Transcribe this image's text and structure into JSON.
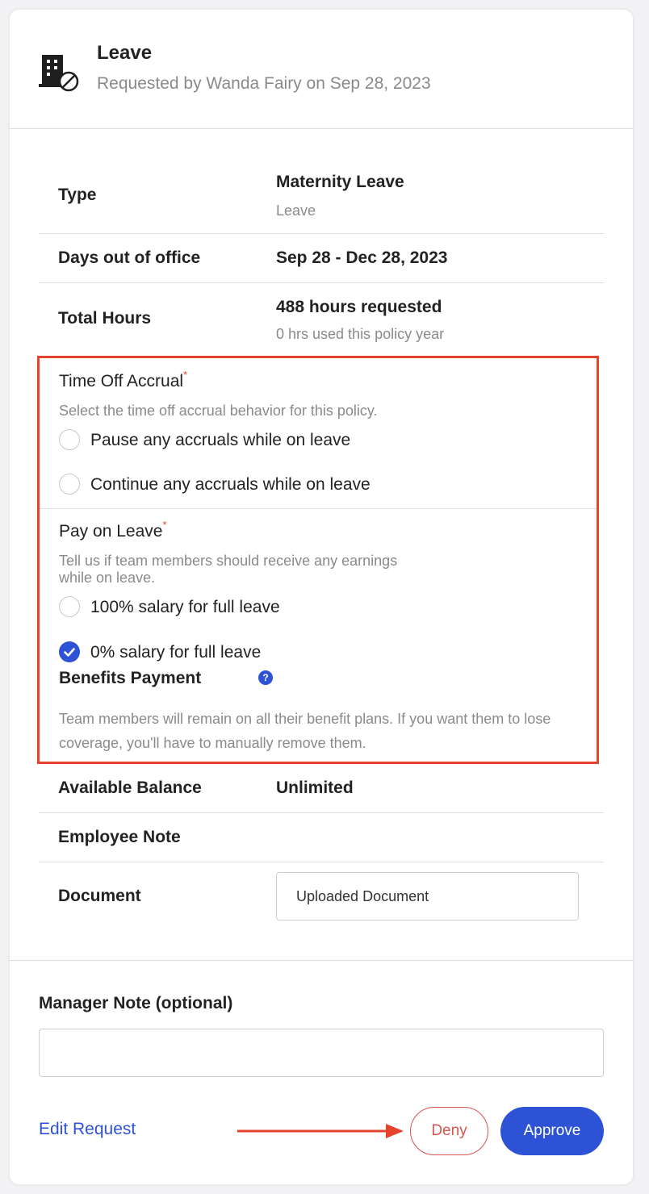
{
  "header": {
    "title": "Leave",
    "subtitle": "Requested by Wanda Fairy on Sep 28, 2023",
    "icon": "building-blocked-icon"
  },
  "details": {
    "type": {
      "label": "Type",
      "value": "Maternity Leave",
      "sub": "Leave"
    },
    "days": {
      "label": "Days out of office",
      "value": "Sep 28 - Dec 28, 2023"
    },
    "hours": {
      "label": "Total Hours",
      "value": "488 hours requested",
      "sub": "0 hrs used this policy year"
    }
  },
  "accrual": {
    "title": "Time Off Accrual",
    "required_mark": "*",
    "description": "Select the time off accrual behavior for this policy.",
    "options": [
      {
        "label": "Pause any accruals while on leave",
        "checked": false
      },
      {
        "label": "Continue any accruals while on leave",
        "checked": false
      }
    ]
  },
  "pay": {
    "title": "Pay on Leave",
    "required_mark": "*",
    "description_line1": "Tell us if team members should receive any earnings",
    "description_line2": "while on leave.",
    "options": [
      {
        "label": "100% salary for full leave",
        "checked": false
      },
      {
        "label": "0% salary for full leave",
        "checked": true
      }
    ]
  },
  "benefits": {
    "title": "Benefits Payment",
    "help_glyph": "?",
    "note": "Team members will remain on all their benefit plans. If you want them to lose coverage, you'll have to manually remove them."
  },
  "balance": {
    "label": "Available Balance",
    "value": "Unlimited"
  },
  "employee_note": {
    "label": "Employee Note"
  },
  "document": {
    "label": "Document",
    "value": "Uploaded Document"
  },
  "manager_note": {
    "label": "Manager Note (optional)",
    "value": ""
  },
  "actions": {
    "edit": "Edit Request",
    "deny": "Deny",
    "approve": "Approve"
  },
  "colors": {
    "accent": "#2d52d6",
    "annotation_red": "#e5432c",
    "deny_red": "#d9534f",
    "muted_text": "#8a8a8a"
  }
}
